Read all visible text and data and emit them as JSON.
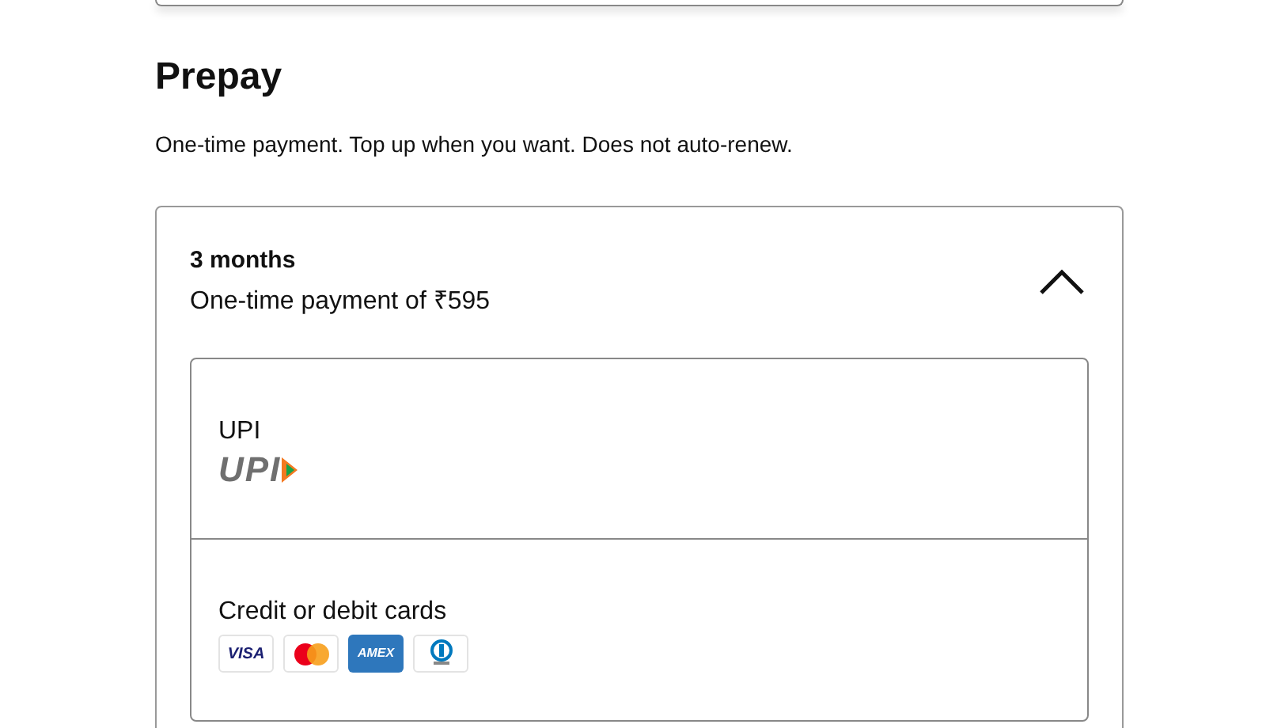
{
  "section": {
    "title": "Prepay",
    "description": "One-time payment. Top up when you want. Does not auto-renew."
  },
  "plan": {
    "name": "3 months",
    "price": "One-time payment of ₹595",
    "expanded": true,
    "payment_methods": [
      {
        "label": "UPI",
        "kind": "upi",
        "logo_text": "UPI"
      },
      {
        "label": "Credit or debit cards",
        "kind": "cards",
        "cards": [
          {
            "kind": "visa",
            "text": "VISA"
          },
          {
            "kind": "mastercard"
          },
          {
            "kind": "amex",
            "text": "AMEX"
          },
          {
            "kind": "diners"
          }
        ]
      }
    ]
  }
}
